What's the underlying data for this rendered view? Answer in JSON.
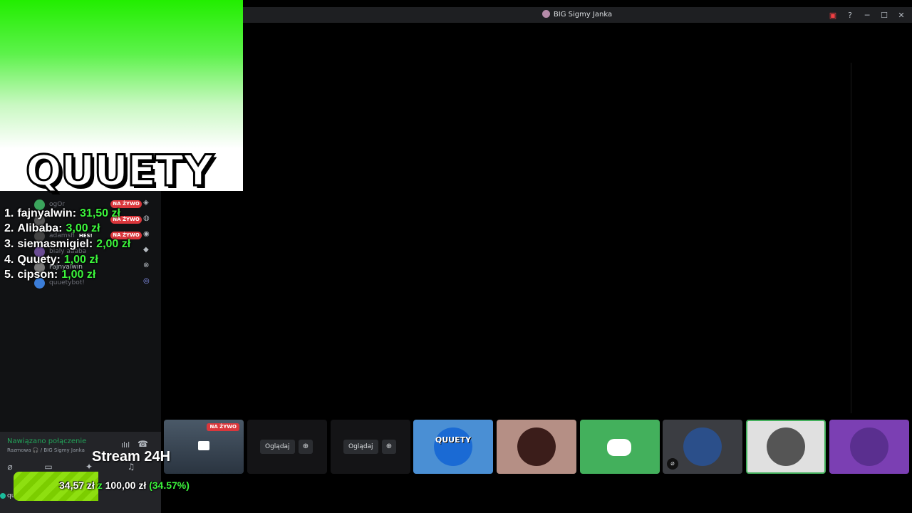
{
  "window": {
    "title": "BIG Sigmy Janka"
  },
  "overlay": {
    "logo_text": "QUUETY",
    "leaderboard": [
      {
        "rank": "1.",
        "name": "fajnyalwin:",
        "amount": "31,50 zł"
      },
      {
        "rank": "2.",
        "name": "Alibaba:",
        "amount": "3,00 zł"
      },
      {
        "rank": "3.",
        "name": "siemasmigiel:",
        "amount": "2,00 zł"
      },
      {
        "rank": "4.",
        "name": "Quuety:",
        "amount": "1,00 zł"
      },
      {
        "rank": "5.",
        "name": "cipson:",
        "amount": "1,00 zł"
      }
    ],
    "stream_title": "Stream 24H",
    "goal": {
      "current": "34,57 zł",
      "separator": "z",
      "target": "100,00 zł",
      "percent_text": "(34.57%)",
      "progress": 0.3457
    }
  },
  "sidebar": {
    "members": [
      {
        "name": "ogOr",
        "live": "NA ŻYWO"
      },
      {
        "name": "",
        "live": "NA ŻYWO"
      },
      {
        "name": "adamsfi",
        "live": "NA ŻYWO",
        "tag": "HES!"
      },
      {
        "name": "bialy aaaba",
        "live": ""
      },
      {
        "name": "Fajnyalwin",
        "live": ""
      },
      {
        "name": "quuetybot!",
        "live": ""
      }
    ]
  },
  "voice": {
    "status": "Nawiązano połączenie",
    "channel": "Rozmowa 🎧 / BIG Sigmy Janka",
    "user": "qu"
  },
  "tiles": [
    {
      "type": "stream",
      "live": "NA ŻYWO"
    },
    {
      "type": "watch",
      "label": "Oglądaj"
    },
    {
      "type": "watch",
      "label": "Oglądaj"
    },
    {
      "type": "avatar",
      "color": "#4a8fd4",
      "text": "QUUETY"
    },
    {
      "type": "avatar",
      "color": "#b58f85"
    },
    {
      "type": "avatar",
      "color": "#43b05c"
    },
    {
      "type": "avatar",
      "color": "#3b3d42"
    },
    {
      "type": "avatar",
      "color": "#e0e0e0"
    },
    {
      "type": "avatar",
      "color": "#7b3fb3"
    }
  ],
  "colors": {
    "accent_green": "#3cf53c",
    "live_red": "#da373c",
    "discord_green": "#43b05c"
  }
}
